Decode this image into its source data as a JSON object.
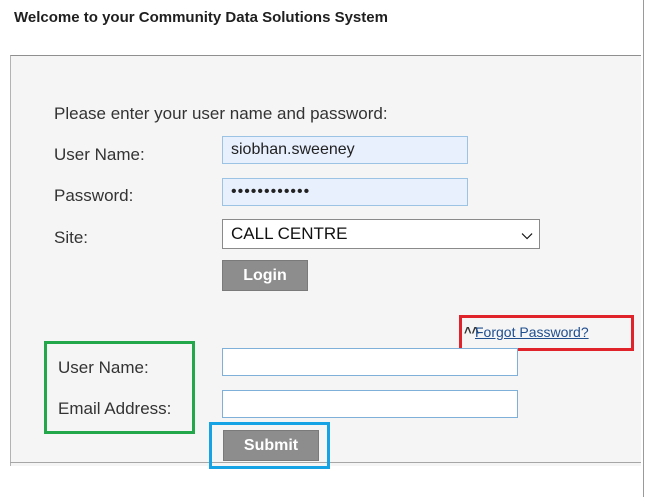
{
  "header": {
    "title": "Welcome to your Community Data Solutions System"
  },
  "login": {
    "intro": "Please enter your user name and password:",
    "username_label": "User Name:",
    "username_value": "siobhan.sweeney",
    "password_label": "Password:",
    "password_value": "••••••••••••",
    "site_label": "Site:",
    "site_value": "CALL CENTRE",
    "login_button": "Login"
  },
  "forgot": {
    "link_label": "Forgot Password?",
    "username_label": "User Name:",
    "email_label": "Email Address:",
    "submit_button": "Submit"
  }
}
